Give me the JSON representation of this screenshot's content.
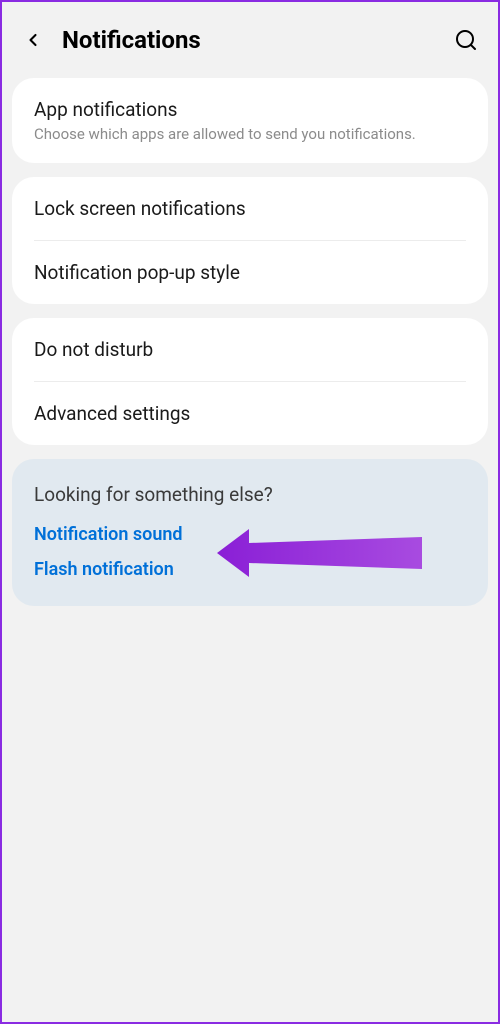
{
  "header": {
    "title": "Notifications"
  },
  "sections": {
    "app_notifications": {
      "title": "App notifications",
      "desc": "Choose which apps are allowed to send you notifications."
    },
    "lock_screen": {
      "title": "Lock screen notifications"
    },
    "popup_style": {
      "title": "Notification pop-up style"
    },
    "dnd": {
      "title": "Do not disturb"
    },
    "advanced": {
      "title": "Advanced settings"
    }
  },
  "info": {
    "title": "Looking for something else?",
    "links": {
      "sound": "Notification sound",
      "flash": "Flash notification"
    }
  }
}
